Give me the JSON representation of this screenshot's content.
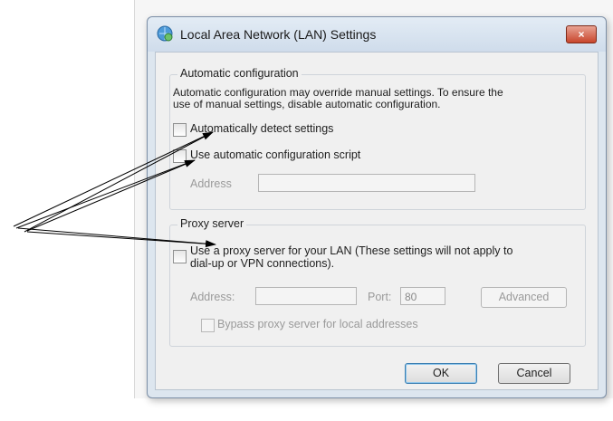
{
  "dialog": {
    "title": "Local Area Network (LAN) Settings",
    "close_label": "×",
    "icon": "network-settings-icon"
  },
  "auto_config": {
    "legend": "Automatic configuration",
    "description_line1": "Automatic configuration may override manual settings.  To ensure the",
    "description_line2": "use of manual settings, disable automatic configuration.",
    "detect_label": "Automatically detect settings",
    "detect_checked": false,
    "script_label": "Use automatic configuration script",
    "script_checked": false,
    "address_label": "Address",
    "address_value": ""
  },
  "proxy": {
    "legend": "Proxy server",
    "use_proxy_line1": "Use a proxy server for your LAN (These settings will not apply to",
    "use_proxy_line2": "dial-up or VPN connections).",
    "use_proxy_checked": false,
    "address_label": "Address:",
    "address_value": "",
    "port_label": "Port:",
    "port_value": "80",
    "advanced_label": "Advanced",
    "bypass_label": "Bypass proxy server for local addresses",
    "bypass_checked": false
  },
  "buttons": {
    "ok": "OK",
    "cancel": "Cancel"
  },
  "colors": {
    "arrow": "#000000",
    "title_gradient_top": "#e3ecf5",
    "close_button": "#c8462c",
    "default_button_border": "#3c7fb1"
  }
}
